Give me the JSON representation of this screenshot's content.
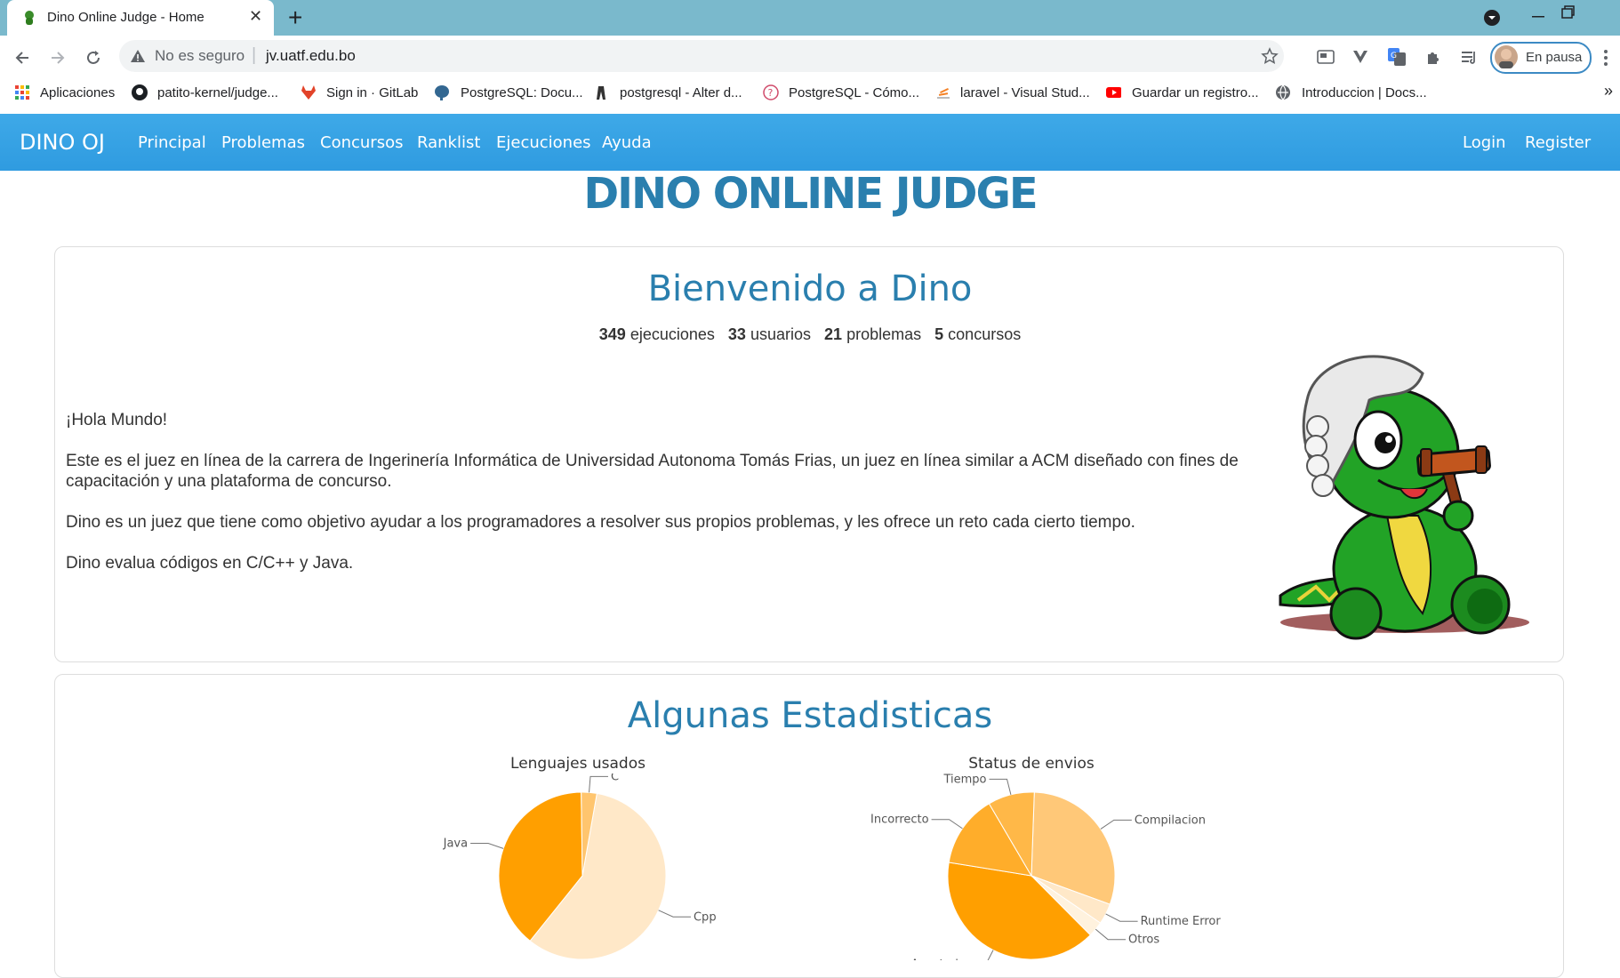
{
  "browser": {
    "tab_title": "Dino Online Judge - Home",
    "tab_close": "✕",
    "new_tab": "+",
    "security_label": "No es seguro",
    "url": "jv.uatf.edu.bo",
    "profile_label": "En pausa",
    "bookmarks": [
      {
        "label": "Aplicaciones"
      },
      {
        "label": "patito-kernel/judge..."
      },
      {
        "label": "Sign in · GitLab"
      },
      {
        "label": "PostgreSQL: Docu..."
      },
      {
        "label": "postgresql - Alter d..."
      },
      {
        "label": "PostgreSQL - Cómo..."
      },
      {
        "label": "laravel - Visual Stud..."
      },
      {
        "label": "Guardar un registro..."
      },
      {
        "label": "Introduccion | Docs..."
      }
    ],
    "bookmarks_overflow": "»"
  },
  "navbar": {
    "brand": "DINO OJ",
    "items": [
      "Principal",
      "Problemas",
      "Concursos",
      "Ranklist",
      "Ejecuciones",
      "Ayuda"
    ],
    "login": "Login",
    "register": "Register",
    "accent": "#3aa6e6"
  },
  "page": {
    "main_title": "DINO ONLINE JUDGE",
    "welcome_title": "Bienvenido a Dino",
    "stats": {
      "executions_count": "349",
      "executions_label": "ejecuciones",
      "users_count": "33",
      "users_label": "usuarios",
      "problems_count": "21",
      "problems_label": "problemas",
      "contests_count": "5",
      "contests_label": "concursos"
    },
    "paragraphs": [
      "¡Hola Mundo!",
      "Este es el juez en línea de la carrera de Ingerinería Informática de Universidad Autonoma Tomás Frias, un juez en línea similar a ACM diseñado con fines de capacitación y una plataforma de concurso.",
      "Dino es un juez que tiene como objetivo ayudar a los programadores a resolver sus propios problemas, y les ofrece un reto cada cierto tiempo.",
      "Dino evalua códigos en C/C++ y Java."
    ],
    "stats_title": "Algunas Estadisticas",
    "title_color": "#2a7fae"
  },
  "chart_data": [
    {
      "type": "pie",
      "title": "Lenguajes usados",
      "slices": [
        {
          "label": "Cpp",
          "value": 58,
          "color": "#ffe8c8"
        },
        {
          "label": "Java",
          "value": 39,
          "color": "#ff9f00"
        },
        {
          "label": "C",
          "value": 3,
          "color": "#ffc56e"
        }
      ]
    },
    {
      "type": "pie",
      "title": "Status de envios",
      "slices": [
        {
          "label": "Compilacion",
          "value": 30,
          "color": "#ffc878"
        },
        {
          "label": "Runtime Error",
          "value": 4,
          "color": "#ffe8c8"
        },
        {
          "label": "Otros",
          "value": 3,
          "color": "#fff2de"
        },
        {
          "label": "Aceptado",
          "value": 40,
          "color": "#ff9f00"
        },
        {
          "label": "Incorrecto",
          "value": 14,
          "color": "#ffad2a"
        },
        {
          "label": "Tiempo",
          "value": 9,
          "color": "#ffb848"
        }
      ]
    }
  ]
}
